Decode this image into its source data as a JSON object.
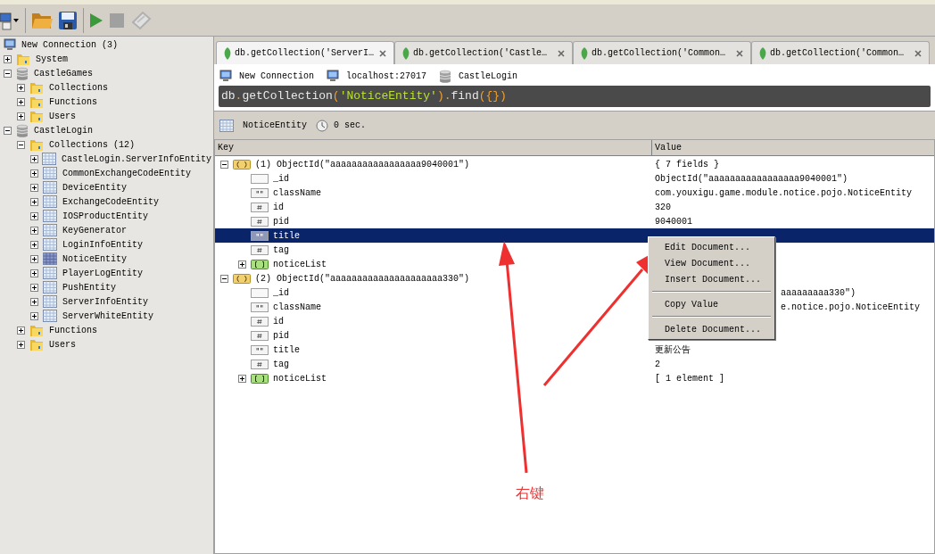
{
  "tree": {
    "label": "New Connection (3)",
    "kind": "server",
    "selected": false,
    "children": [
      {
        "label": "System",
        "kind": "folder",
        "expanded": false,
        "selected": false
      },
      {
        "label": "CastleGames",
        "kind": "database",
        "expanded": true,
        "selected": false,
        "children": [
          {
            "label": "Collections",
            "kind": "folder",
            "expanded": false,
            "selected": false
          },
          {
            "label": "Functions",
            "kind": "folder",
            "expanded": false,
            "selected": false
          },
          {
            "label": "Users",
            "kind": "folder",
            "expanded": false,
            "selected": false
          }
        ]
      },
      {
        "label": "CastleLogin",
        "kind": "database",
        "expanded": true,
        "selected": false,
        "children": [
          {
            "label": "Collections (12)",
            "kind": "folder",
            "expanded": true,
            "selected": false,
            "children": [
              {
                "label": "CastleLogin.ServerInfoEntity",
                "kind": "collection",
                "expanded": false,
                "selected": false
              },
              {
                "label": "CommonExchangeCodeEntity",
                "kind": "collection",
                "expanded": false,
                "selected": false
              },
              {
                "label": "DeviceEntity",
                "kind": "collection",
                "expanded": false,
                "selected": false
              },
              {
                "label": "ExchangeCodeEntity",
                "kind": "collection",
                "expanded": false,
                "selected": false
              },
              {
                "label": "IOSProductEntity",
                "kind": "collection",
                "expanded": false,
                "selected": false
              },
              {
                "label": "KeyGenerator",
                "kind": "collection",
                "expanded": false,
                "selected": false
              },
              {
                "label": "LoginInfoEntity",
                "kind": "collection",
                "expanded": false,
                "selected": false
              },
              {
                "label": "NoticeEntity",
                "kind": "collection",
                "expanded": false,
                "selected": true
              },
              {
                "label": "PlayerLogEntity",
                "kind": "collection",
                "expanded": false,
                "selected": false
              },
              {
                "label": "PushEntity",
                "kind": "collection",
                "expanded": false,
                "selected": false
              },
              {
                "label": "ServerInfoEntity",
                "kind": "collection",
                "expanded": false,
                "selected": false
              },
              {
                "label": "ServerWhiteEntity",
                "kind": "collection",
                "expanded": false,
                "selected": false
              }
            ]
          },
          {
            "label": "Functions",
            "kind": "folder",
            "expanded": false,
            "selected": false
          },
          {
            "label": "Users",
            "kind": "folder",
            "expanded": false,
            "selected": false
          }
        ]
      }
    ]
  },
  "tabs": [
    {
      "label": "db.getCollection('ServerI…",
      "selected": true
    },
    {
      "label": "db.getCollection('Castle…",
      "selected": false
    },
    {
      "label": "db.getCollection('Common…",
      "selected": false
    },
    {
      "label": "db.getCollection('Common…",
      "selected": false
    }
  ],
  "breadcrumb": [
    {
      "kind": "server",
      "label": "New Connection"
    },
    {
      "kind": "host",
      "label": "localhost:27017"
    },
    {
      "kind": "database",
      "label": "CastleLogin"
    }
  ],
  "query": [
    {
      "kind": "plain",
      "text": "db"
    },
    {
      "kind": "punct",
      "text": "."
    },
    {
      "kind": "plain",
      "text": "getCollection"
    },
    {
      "kind": "punct",
      "text": "("
    },
    {
      "kind": "string",
      "text": "'NoticeEntity'"
    },
    {
      "kind": "punct",
      "text": ")."
    },
    {
      "kind": "plain",
      "text": "find"
    },
    {
      "kind": "punct",
      "text": "({})"
    }
  ],
  "result_bar": {
    "collection": "NoticeEntity",
    "time": "0 sec."
  },
  "table": {
    "columns": [
      "Key",
      "Value"
    ],
    "rows": [
      {
        "key": "(1) ObjectId(\"aaaaaaaaaaaaaaaaa9040001\")",
        "kind": "object",
        "value": "{ 7 fields }",
        "expanded": true,
        "selected": false,
        "children": [
          {
            "key": "_id",
            "kind": "objectid",
            "value": "ObjectId(\"aaaaaaaaaaaaaaaaa9040001\")",
            "selected": false
          },
          {
            "key": "className",
            "kind": "string",
            "value": "com.youxigu.game.module.notice.pojo.NoticeEntity",
            "selected": false
          },
          {
            "key": "id",
            "kind": "number",
            "value": "320",
            "selected": false
          },
          {
            "key": "pid",
            "kind": "number",
            "value": "9040001",
            "selected": false
          },
          {
            "key": "title",
            "kind": "string",
            "selected": true
          },
          {
            "key": "tag",
            "kind": "number",
            "selected": false
          },
          {
            "key": "noticeList",
            "kind": "array",
            "expanded": false,
            "selected": false
          }
        ]
      },
      {
        "key": "(2) ObjectId(\"aaaaaaaaaaaaaaaaaaaaa330\")",
        "kind": "object",
        "expanded": true,
        "selected": false,
        "children": [
          {
            "key": "_id",
            "kind": "objectid",
            "value": "aaaaaaaaa330\")",
            "under_menu": true,
            "selected": false
          },
          {
            "key": "className",
            "kind": "string",
            "value": "e.notice.pojo.NoticeEntity",
            "under_menu": true,
            "selected": false
          },
          {
            "key": "id",
            "kind": "number",
            "selected": false
          },
          {
            "key": "pid",
            "kind": "number",
            "selected": false
          },
          {
            "key": "title",
            "kind": "string",
            "value": "更新公告",
            "selected": false
          },
          {
            "key": "tag",
            "kind": "number",
            "value": "2",
            "selected": false
          },
          {
            "key": "noticeList",
            "kind": "array",
            "value": "[ 1 element ]",
            "expanded": false,
            "selected": false
          }
        ]
      }
    ]
  },
  "context_menu": [
    {
      "kind": "item",
      "label": "Edit Document..."
    },
    {
      "kind": "item",
      "label": "View Document..."
    },
    {
      "kind": "item",
      "label": "Insert Document..."
    },
    {
      "kind": "separator"
    },
    {
      "kind": "item",
      "label": "Copy Value"
    },
    {
      "kind": "separator"
    },
    {
      "kind": "item",
      "label": "Delete Document..."
    }
  ],
  "annotation": {
    "label": "右键"
  }
}
